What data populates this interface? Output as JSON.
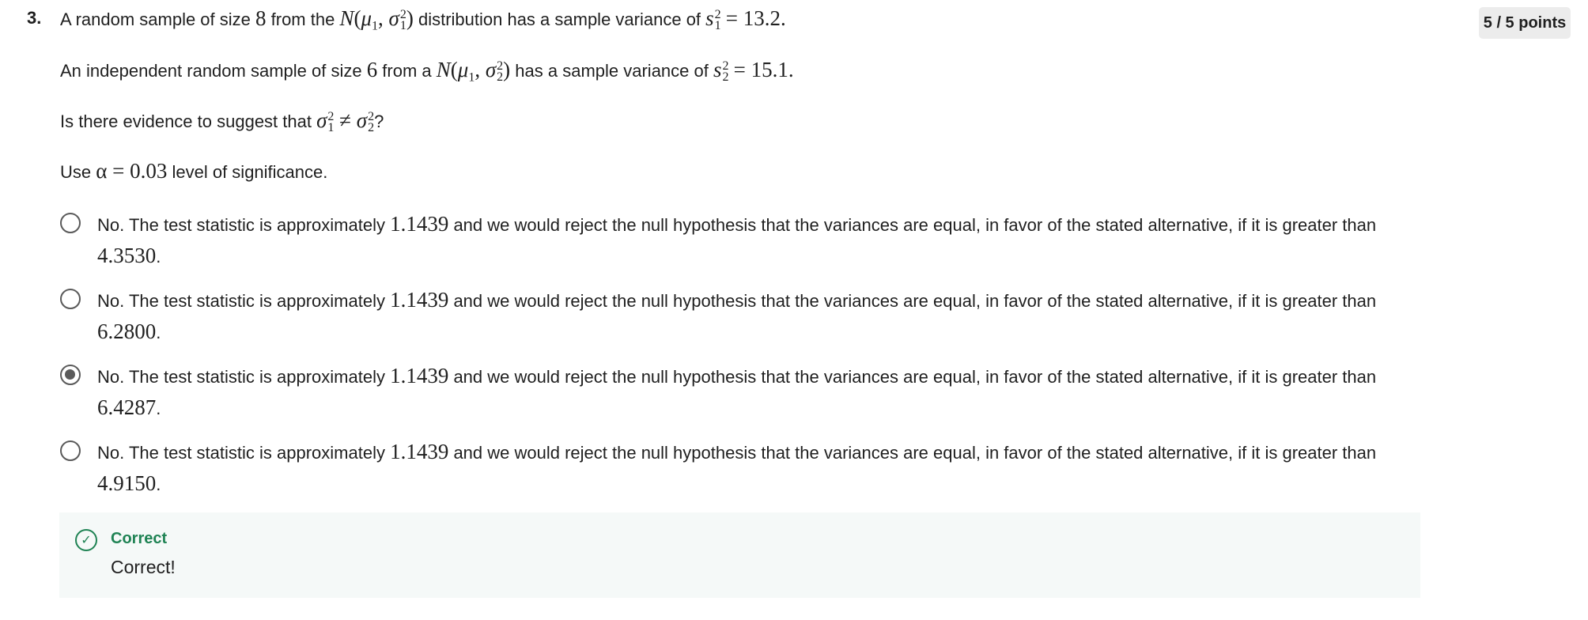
{
  "question": {
    "number": "3.",
    "points": "5 / 5 points",
    "line1": {
      "a": "A random sample of size ",
      "n": "8",
      "b": " from the ",
      "c": " distribution has a sample variance of ",
      "val": "= 13.2."
    },
    "line2": {
      "a": "An independent random sample of size ",
      "n": "6",
      "b": " from a ",
      "c": " has a sample variance of ",
      "val": "= 15.1."
    },
    "line3": {
      "a": "Is there evidence to suggest that ",
      "b": "?"
    },
    "line4": {
      "a": "Use ",
      "alpha": "α = 0.03",
      "b": " level of significance."
    }
  },
  "options": [
    {
      "text": "No. The test statistic is approximately ",
      "stat": "1.1439",
      "mid": " and we would reject the null hypothesis that the variances are equal, in favor of the stated alternative, if it is greater than ",
      "crit": "4.3530",
      "selected": false
    },
    {
      "text": "No. The test statistic is approximately ",
      "stat": "1.1439",
      "mid": " and we would reject the null hypothesis that the variances are equal, in favor of the stated alternative, if it is greater than ",
      "crit": "6.2800",
      "selected": false
    },
    {
      "text": "No. The test statistic is approximately ",
      "stat": "1.1439",
      "mid": " and we would reject the null hypothesis that the variances are equal, in favor of the stated alternative, if it is greater than ",
      "crit": "6.4287",
      "selected": true
    },
    {
      "text": "No. The test statistic is approximately ",
      "stat": "1.1439",
      "mid": " and we would reject the null hypothesis that the variances are equal, in favor of the stated alternative, if it is greater than ",
      "crit": "4.9150",
      "selected": false
    }
  ],
  "feedback": {
    "title": "Correct",
    "message": "Correct!",
    "color": "#1f8354"
  }
}
